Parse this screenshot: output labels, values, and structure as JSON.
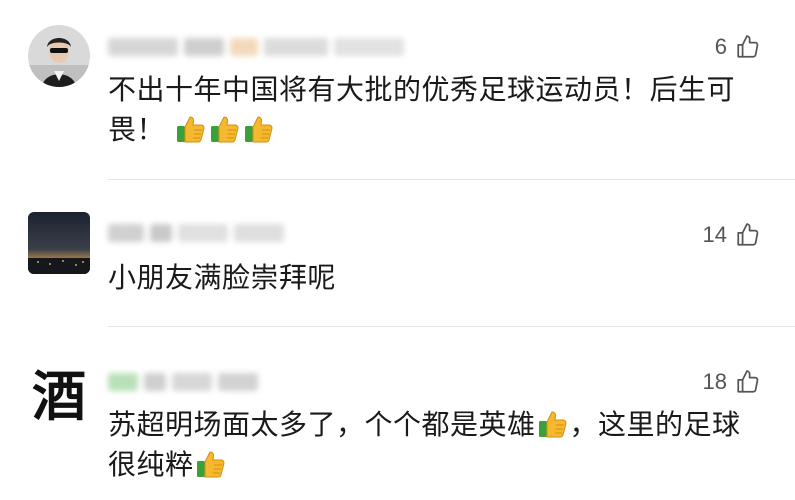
{
  "comments": [
    {
      "text_a": "不出十年中国将有大批的优秀足球运动员！后生可畏！",
      "likes": "6",
      "avatar": "user-photo"
    },
    {
      "text_a": "小朋友满脸崇拜呢",
      "likes": "14",
      "avatar": "night-city-photo"
    },
    {
      "text_a": "苏超明场面太多了，个个都是英雄",
      "text_b": "，这里的足球很纯粹",
      "likes": "18",
      "avatar": "calligraphy",
      "avatar_char": "酒"
    }
  ],
  "colors": {
    "text": "#1a1a1a",
    "likes": "#555555",
    "divider": "#e5e5e5",
    "thumb_yellow": "#f5b82e",
    "thumb_green": "#3aa13a"
  },
  "icons": [
    "thumbs-up-icon",
    "thumbs-up-emoji"
  ]
}
